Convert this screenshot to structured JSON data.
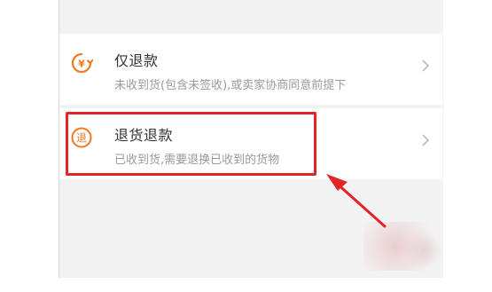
{
  "options": [
    {
      "icon": "refund-yen-icon",
      "title": "仅退款",
      "subtitle": "未收到货(包含未签收),或卖家协商同意前提下"
    },
    {
      "icon": "return-refund-icon",
      "icon_char": "退",
      "title": "退货退款",
      "subtitle": "已收到货,需要退换已收到的货物"
    }
  ],
  "colors": {
    "accent_orange": "#f07a22",
    "highlight_red": "#e0242a",
    "chevron_gray": "#bbbbbb"
  }
}
